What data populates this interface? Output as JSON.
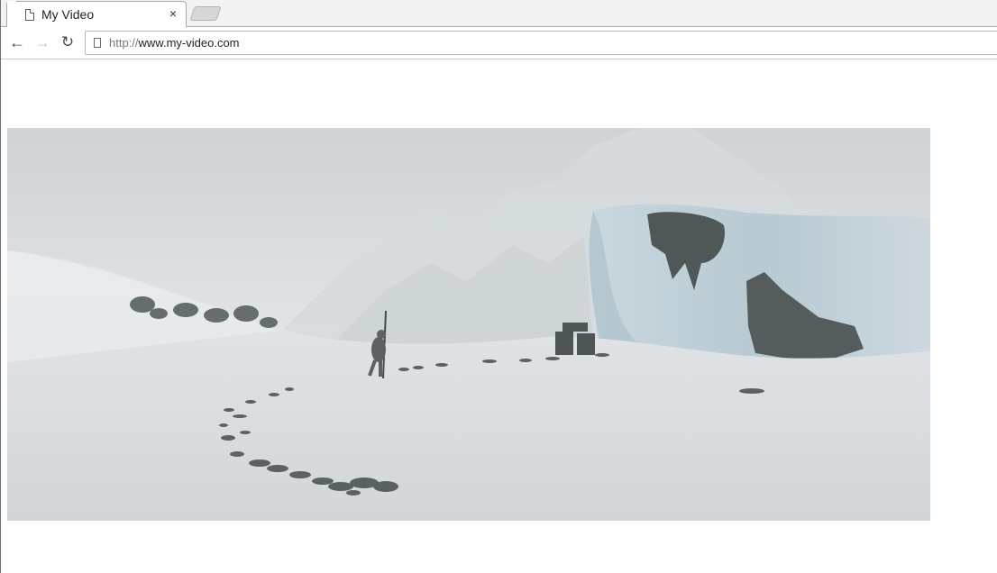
{
  "tab": {
    "title": "My Video",
    "close_glyph": "×",
    "icon": "page-icon"
  },
  "toolbar": {
    "back_glyph": "←",
    "forward_glyph": "→",
    "reload_glyph": "↻"
  },
  "address": {
    "scheme": "http://",
    "host": "www.my-video.com"
  },
  "video": {
    "scene": "snowy-mountain-landscape"
  }
}
